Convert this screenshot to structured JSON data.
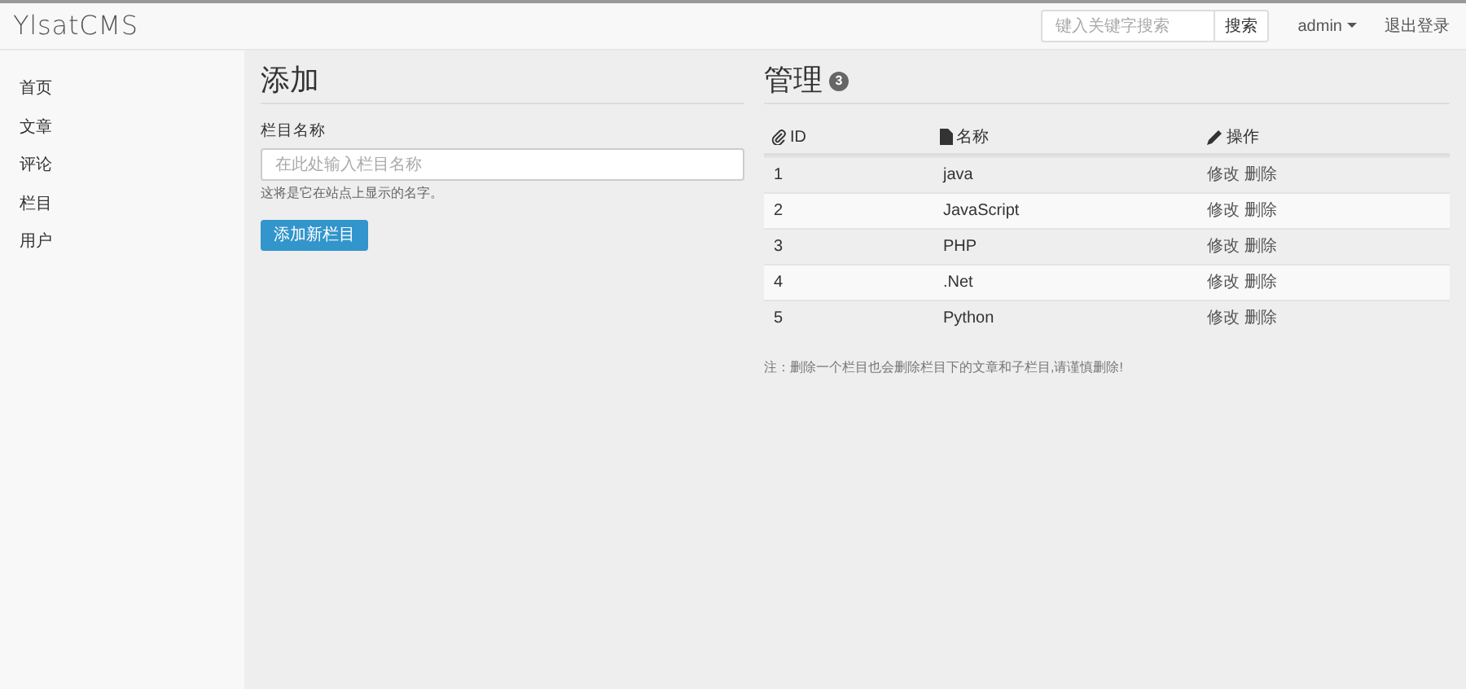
{
  "navbar": {
    "brand": "YlsatCMS",
    "search": {
      "placeholder": "键入关键字搜索",
      "button": "搜索"
    },
    "user": "admin",
    "logout": "退出登录"
  },
  "sidebar": {
    "items": [
      {
        "label": "首页"
      },
      {
        "label": "文章"
      },
      {
        "label": "评论"
      },
      {
        "label": "栏目"
      },
      {
        "label": "用户"
      }
    ]
  },
  "add_panel": {
    "title": "添加",
    "field_label": "栏目名称",
    "placeholder": "在此处输入栏目名称",
    "help": "这将是它在站点上显示的名字。",
    "button": "添加新栏目"
  },
  "manage_panel": {
    "title": "管理",
    "badge": "3",
    "columns": [
      "ID",
      "名称",
      "操作"
    ],
    "rows": [
      {
        "id": "1",
        "name": "java",
        "actions": [
          "修改",
          "删除"
        ]
      },
      {
        "id": "2",
        "name": "JavaScript",
        "actions": [
          "修改",
          "删除"
        ]
      },
      {
        "id": "3",
        "name": "PHP",
        "actions": [
          "修改",
          "删除"
        ]
      },
      {
        "id": "4",
        "name": ".Net",
        "actions": [
          "修改",
          "删除"
        ]
      },
      {
        "id": "5",
        "name": "Python",
        "actions": [
          "修改",
          "删除"
        ]
      }
    ],
    "note": "注：删除一个栏目也会删除栏目下的文章和子栏目,请谨慎删除!"
  }
}
